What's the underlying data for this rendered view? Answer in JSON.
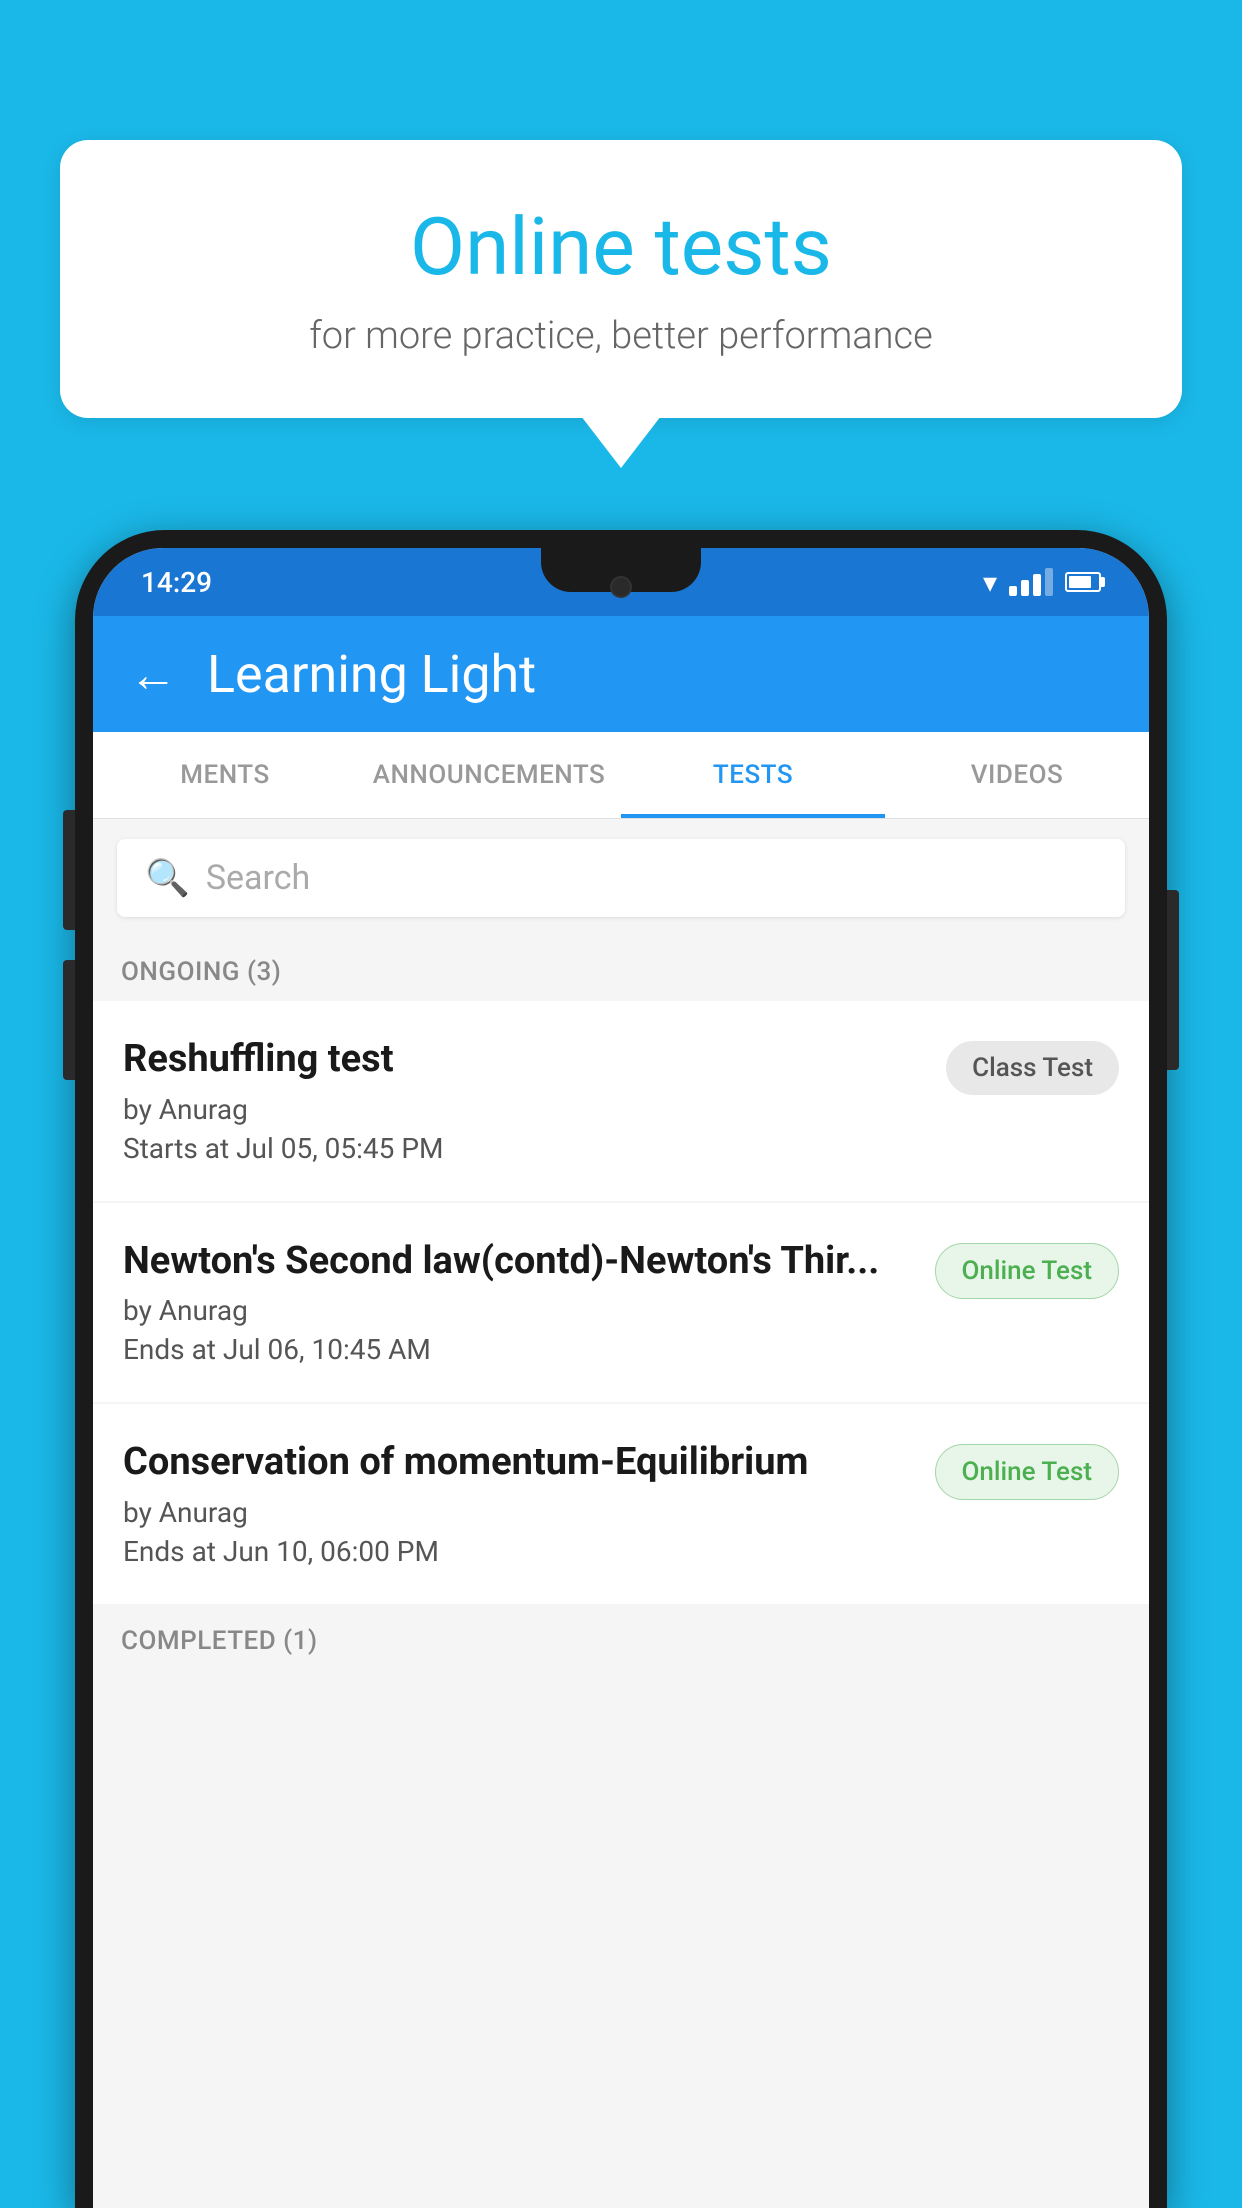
{
  "background_color": "#1AB8E8",
  "bubble": {
    "title": "Online tests",
    "subtitle": "for more practice, better performance"
  },
  "status_bar": {
    "time": "14:29",
    "wifi": "▼",
    "battery_percent": 70
  },
  "app_bar": {
    "back_label": "←",
    "title": "Learning Light"
  },
  "tabs": [
    {
      "label": "MENTS",
      "active": false
    },
    {
      "label": "ANNOUNCEMENTS",
      "active": false
    },
    {
      "label": "TESTS",
      "active": true
    },
    {
      "label": "VIDEOS",
      "active": false
    }
  ],
  "search": {
    "placeholder": "Search"
  },
  "ongoing_section": {
    "title": "ONGOING (3)",
    "tests": [
      {
        "name": "Reshuffling test",
        "by": "by Anurag",
        "time": "Starts at  Jul 05, 05:45 PM",
        "badge": "Class Test",
        "badge_type": "class"
      },
      {
        "name": "Newton's Second law(contd)-Newton's Thir...",
        "by": "by Anurag",
        "time": "Ends at  Jul 06, 10:45 AM",
        "badge": "Online Test",
        "badge_type": "online"
      },
      {
        "name": "Conservation of momentum-Equilibrium",
        "by": "by Anurag",
        "time": "Ends at  Jun 10, 06:00 PM",
        "badge": "Online Test",
        "badge_type": "online"
      }
    ]
  },
  "completed_section": {
    "title": "COMPLETED (1)"
  }
}
